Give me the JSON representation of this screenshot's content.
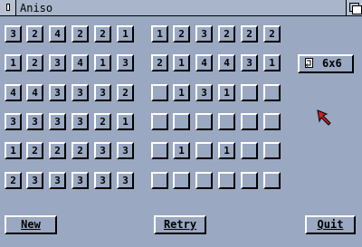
{
  "window": {
    "title": "Aniso"
  },
  "left_grid": [
    [
      "3",
      "2",
      "4",
      "2",
      "2",
      "1"
    ],
    [
      "1",
      "2",
      "3",
      "4",
      "1",
      "3"
    ],
    [
      "4",
      "4",
      "3",
      "3",
      "3",
      "2"
    ],
    [
      "3",
      "3",
      "3",
      "3",
      "2",
      "1"
    ],
    [
      "1",
      "2",
      "2",
      "2",
      "3",
      "3"
    ],
    [
      "2",
      "3",
      "3",
      "3",
      "3",
      "3"
    ]
  ],
  "right_grid": [
    [
      "1",
      "2",
      "3",
      "2",
      "2",
      "2"
    ],
    [
      "2",
      "1",
      "4",
      "4",
      "3",
      "1"
    ],
    [
      "",
      "1",
      "3",
      "1",
      "",
      ""
    ],
    [
      "",
      "",
      "",
      "",
      "",
      ""
    ],
    [
      "",
      "1",
      "",
      "1",
      "",
      ""
    ],
    [
      "",
      "",
      "",
      "",
      "",
      ""
    ]
  ],
  "size_button": {
    "label": "6x6"
  },
  "buttons": {
    "new": "New",
    "retry": "Retry",
    "quit": "Quit"
  },
  "colors": {
    "background": "#9aa8c1",
    "pointer": "#cc2222"
  }
}
